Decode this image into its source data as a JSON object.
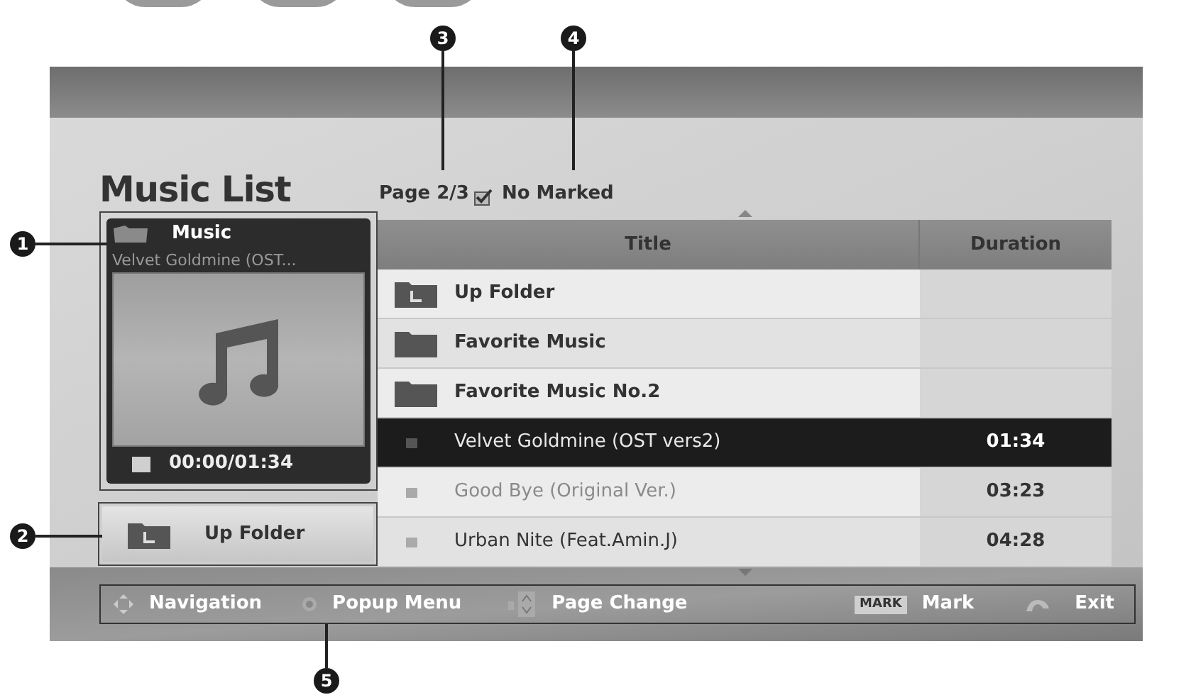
{
  "callouts": [
    {
      "label": "3"
    },
    {
      "label": "4"
    },
    {
      "label": "1"
    },
    {
      "label": "2"
    },
    {
      "label": "5"
    }
  ],
  "title": "Music List",
  "page": "Page 2/3",
  "mark_status": "No Marked",
  "now_playing": {
    "category": "Music",
    "track": "Velvet Goldmine (OST...",
    "time": "00:00/01:34"
  },
  "up_folder_button": "Up Folder",
  "table": {
    "columns": [
      "Title",
      "Duration"
    ],
    "rows": [
      {
        "kind": "up",
        "title": "Up Folder",
        "selected": false,
        "disabled": false
      },
      {
        "kind": "folder",
        "title": "Favorite Music",
        "selected": false,
        "disabled": false
      },
      {
        "kind": "folder",
        "title": "Favorite Music No.2",
        "selected": false,
        "disabled": false
      },
      {
        "kind": "track",
        "title": "Velvet Goldmine (OST vers2)",
        "duration": "01:34",
        "selected": true,
        "disabled": false
      },
      {
        "kind": "track",
        "title": "Good Bye (Original Ver.)",
        "duration": "03:23",
        "selected": false,
        "disabled": true
      },
      {
        "kind": "track",
        "title": "Urban Nite (Feat.Amin.J)",
        "duration": "04:28",
        "selected": false,
        "disabled": false
      }
    ]
  },
  "footer": [
    {
      "kind": "nav",
      "label": "Navigation"
    },
    {
      "kind": "ok",
      "label": "Popup Menu"
    },
    {
      "kind": "page",
      "label": "Page Change"
    },
    {
      "kind": "mark",
      "key": "MARK",
      "label": "Mark"
    },
    {
      "kind": "exit",
      "label": "Exit"
    }
  ]
}
